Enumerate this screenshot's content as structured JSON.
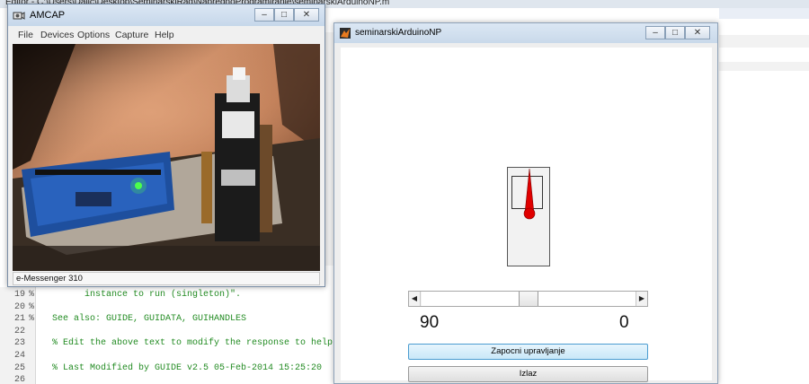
{
  "editor": {
    "title": "Editor - C:\\Users\\Dalic\\Desktop\\SeminarskiRad\\NaprednoProgramiranje\\seminarskiArduinoNP.m",
    "lines": [
      {
        "number": "19",
        "marker": "%",
        "text": "      instance to run (singleton)\"."
      },
      {
        "number": "20",
        "marker": "%",
        "text": ""
      },
      {
        "number": "21",
        "marker": "%",
        "text": "See also: GUIDE, GUIDATA, GUIHANDLES"
      },
      {
        "number": "22",
        "marker": "",
        "text": ""
      },
      {
        "number": "23",
        "marker": "",
        "text": "% Edit the above text to modify the response to help"
      },
      {
        "number": "24",
        "marker": "",
        "text": ""
      },
      {
        "number": "25",
        "marker": "",
        "text": "% Last Modified by GUIDE v2.5 05-Feb-2014 15:25:20"
      },
      {
        "number": "26",
        "marker": "",
        "text": ""
      }
    ]
  },
  "amcap": {
    "title": "AMCAP",
    "window_buttons": {
      "minimize": "–",
      "maximize": "□",
      "close": "✕"
    },
    "menu": [
      "File",
      "Devices",
      "Options",
      "Capture",
      "Help"
    ],
    "status": "e-Messenger 310",
    "icon": "amcap-camera-icon"
  },
  "figure_window": {
    "title": "seminarskiArduinoNP",
    "icon": "matlab-icon",
    "window_buttons": {
      "minimize": "–",
      "maximize": "□",
      "close": "✕"
    },
    "slider": {
      "left_arrow": "◀",
      "right_arrow": "▶",
      "min": 0,
      "max": 180,
      "value": 90
    },
    "readout_left": "90",
    "readout_right": "0",
    "start_button": "Zapocni upravljanje",
    "exit_button": "Izlaz",
    "needle_color": "#e00000"
  }
}
